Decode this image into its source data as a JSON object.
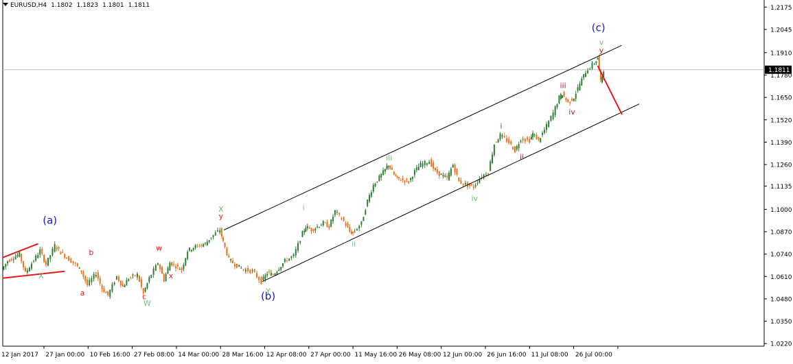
{
  "header": {
    "symbol": "EURUSD,H4",
    "open": "1.1802",
    "high": "1.1823",
    "low": "1.1801",
    "close": "1.1811"
  },
  "colors": {
    "bull_candle": "#2e7d32",
    "bear_candle": "#e8711a",
    "wave_red": "#e41b1b",
    "wave_green": "#6cc070",
    "wave_blue": "#1a1ad4",
    "minor_red": "#c2185b",
    "channel": "#000000",
    "axis": "#000000",
    "current_price_line": "#c0c0c0"
  },
  "chart_data": {
    "type": "candlestick",
    "title": "EURUSD,H4",
    "ylim": [
      1.0205,
      1.2208
    ],
    "y_ticks": [
      "1.2175",
      "1.2045",
      "1.1910",
      "1.1780",
      "1.1650",
      "1.1520",
      "1.1390",
      "1.1260",
      "1.1135",
      "1.1000",
      "1.0870",
      "1.0740",
      "1.0610",
      "1.0480",
      "1.0350",
      "1.0220"
    ],
    "x_ticks": [
      "12 Jan 2017",
      "27 Jan 00:00",
      "10 Feb 16:00",
      "27 Feb 08:00",
      "14 Mar 00:00",
      "28 Mar 16:00",
      "12 Apr 08:00",
      "27 Apr 00:00",
      "11 May 16:00",
      "26 May 08:00",
      "12 Jun 00:00",
      "26 Jun 16:00",
      "11 Jul 08:00",
      "26 Jul 00:00"
    ],
    "current_price": "1.1811",
    "grid": false,
    "price_path": [
      {
        "date": "12 Jan 2017",
        "price": 1.065
      },
      {
        "date": "14 Jan 2017",
        "price": 1.07
      },
      {
        "date": "18 Jan 2017",
        "price": 1.074
      },
      {
        "date": "20 Jan 2017",
        "price": 1.063
      },
      {
        "date": "25 Jan 2017",
        "price": 1.076
      },
      {
        "date": "27 Jan 2017",
        "price": 1.068
      },
      {
        "date": "30 Jan 2017",
        "price": 1.079
      },
      {
        "date": "01 Feb 2017",
        "price": 1.075
      },
      {
        "date": "03 Feb 2017",
        "price": 1.072
      },
      {
        "date": "06 Feb 2017",
        "price": 1.068
      },
      {
        "date": "08 Feb 2017",
        "price": 1.064
      },
      {
        "date": "10 Feb 2017",
        "price": 1.056
      },
      {
        "date": "13 Feb 2017",
        "price": 1.063
      },
      {
        "date": "15 Feb 2017",
        "price": 1.054
      },
      {
        "date": "17 Feb 2017",
        "price": 1.05
      },
      {
        "date": "20 Feb 2017",
        "price": 1.061
      },
      {
        "date": "22 Feb 2017",
        "price": 1.055
      },
      {
        "date": "24 Feb 2017",
        "price": 1.06
      },
      {
        "date": "27 Feb 2017",
        "price": 1.062
      },
      {
        "date": "01 Mar 2017",
        "price": 1.051
      },
      {
        "date": "03 Mar 2017",
        "price": 1.06
      },
      {
        "date": "06 Mar 2017",
        "price": 1.069
      },
      {
        "date": "08 Mar 2017",
        "price": 1.059
      },
      {
        "date": "10 Mar 2017",
        "price": 1.069
      },
      {
        "date": "14 Mar 2017",
        "price": 1.065
      },
      {
        "date": "16 Mar 2017",
        "price": 1.076
      },
      {
        "date": "18 Mar 2017",
        "price": 1.078
      },
      {
        "date": "22 Mar 2017",
        "price": 1.08
      },
      {
        "date": "24 Mar 2017",
        "price": 1.084
      },
      {
        "date": "27 Mar 2017",
        "price": 1.088
      },
      {
        "date": "28 Mar 2017",
        "price": 1.081
      },
      {
        "date": "30 Mar 2017",
        "price": 1.071
      },
      {
        "date": "01 Apr 2017",
        "price": 1.068
      },
      {
        "date": "04 Apr 2017",
        "price": 1.065
      },
      {
        "date": "07 Apr 2017",
        "price": 1.064
      },
      {
        "date": "10 Apr 2017",
        "price": 1.058
      },
      {
        "date": "12 Apr 2017",
        "price": 1.063
      },
      {
        "date": "14 Apr 2017",
        "price": 1.062
      },
      {
        "date": "18 Apr 2017",
        "price": 1.07
      },
      {
        "date": "21 Apr 2017",
        "price": 1.073
      },
      {
        "date": "24 Apr 2017",
        "price": 1.086
      },
      {
        "date": "25 Apr 2017",
        "price": 1.09
      },
      {
        "date": "27 Apr 2017",
        "price": 1.088
      },
      {
        "date": "01 May 2017",
        "price": 1.092
      },
      {
        "date": "03 May 2017",
        "price": 1.09
      },
      {
        "date": "05 May 2017",
        "price": 1.099
      },
      {
        "date": "08 May 2017",
        "price": 1.093
      },
      {
        "date": "10 May 2017",
        "price": 1.087
      },
      {
        "date": "11 May 2017",
        "price": 1.086
      },
      {
        "date": "14 May 2017",
        "price": 1.092
      },
      {
        "date": "16 May 2017",
        "price": 1.105
      },
      {
        "date": "18 May 2017",
        "price": 1.114
      },
      {
        "date": "22 May 2017",
        "price": 1.123
      },
      {
        "date": "23 May 2017",
        "price": 1.126
      },
      {
        "date": "25 May 2017",
        "price": 1.12
      },
      {
        "date": "26 May 2017",
        "price": 1.118
      },
      {
        "date": "30 May 2017",
        "price": 1.116
      },
      {
        "date": "01 Jun 2017",
        "price": 1.122
      },
      {
        "date": "03 Jun 2017",
        "price": 1.126
      },
      {
        "date": "06 Jun 2017",
        "price": 1.128
      },
      {
        "date": "08 Jun 2017",
        "price": 1.122
      },
      {
        "date": "10 Jun 2017",
        "price": 1.12
      },
      {
        "date": "12 Jun 2017",
        "price": 1.118
      },
      {
        "date": "14 Jun 2017",
        "price": 1.126
      },
      {
        "date": "16 Jun 2017",
        "price": 1.116
      },
      {
        "date": "19 Jun 2017",
        "price": 1.114
      },
      {
        "date": "21 Jun 2017",
        "price": 1.113
      },
      {
        "date": "23 Jun 2017",
        "price": 1.118
      },
      {
        "date": "26 Jun 2017",
        "price": 1.122
      },
      {
        "date": "28 Jun 2017",
        "price": 1.138
      },
      {
        "date": "30 Jun 2017",
        "price": 1.143
      },
      {
        "date": "03 Jul 2017",
        "price": 1.139
      },
      {
        "date": "05 Jul 2017",
        "price": 1.134
      },
      {
        "date": "07 Jul 2017",
        "price": 1.141
      },
      {
        "date": "10 Jul 2017",
        "price": 1.14
      },
      {
        "date": "11 Jul 2017",
        "price": 1.144
      },
      {
        "date": "13 Jul 2017",
        "price": 1.14
      },
      {
        "date": "15 Jul 2017",
        "price": 1.146
      },
      {
        "date": "18 Jul 2017",
        "price": 1.156
      },
      {
        "date": "20 Jul 2017",
        "price": 1.165
      },
      {
        "date": "21 Jul 2017",
        "price": 1.167
      },
      {
        "date": "23 Jul 2017",
        "price": 1.162
      },
      {
        "date": "25 Jul 2017",
        "price": 1.165
      },
      {
        "date": "27 Jul 2017",
        "price": 1.173
      },
      {
        "date": "29 Jul 2017",
        "price": 1.18
      },
      {
        "date": "01 Aug 2017",
        "price": 1.185
      },
      {
        "date": "02 Aug 2017",
        "price": 1.188
      },
      {
        "date": "03 Aug 2017",
        "price": 1.174
      },
      {
        "date": "04 Aug 2017",
        "price": 1.1811
      }
    ],
    "channel_lines": [
      {
        "name": "upper",
        "points": [
          {
            "date": "28 Mar 2017",
            "price": 1.088
          },
          {
            "date": "04 Aug 2017",
            "price": 1.192
          }
        ]
      },
      {
        "name": "lower",
        "points": [
          {
            "date": "10 Apr 2017",
            "price": 1.058
          },
          {
            "date": "10 Aug 2017",
            "price": 1.158
          }
        ]
      }
    ],
    "triangle_lines": [
      {
        "name": "top",
        "points": [
          {
            "date": "12 Jan 2017",
            "price": 1.072
          },
          {
            "date": "24 Jan 2017",
            "price": 1.08
          }
        ]
      },
      {
        "name": "bottom",
        "points": [
          {
            "date": "12 Jan 2017",
            "price": 1.06
          },
          {
            "date": "02 Feb 2017",
            "price": 1.064
          }
        ]
      }
    ],
    "projection_line": {
      "points": [
        {
          "date": "05 Aug 2017",
          "price": 1.181
        },
        {
          "date": "10 Aug 2017",
          "price": 1.155
        }
      ]
    },
    "wave_labels": [
      {
        "text": "(a)",
        "date": "28 Jan 2017",
        "price": 1.0915,
        "color": "blue"
      },
      {
        "text": "X",
        "date": "25 Jan 2017",
        "price": 1.06,
        "color": "green"
      },
      {
        "text": "a",
        "date": "08 Feb 2017",
        "price": 1.05,
        "color": "red"
      },
      {
        "text": "b",
        "date": "11 Feb 2017",
        "price": 1.0735,
        "color": "red"
      },
      {
        "text": "c",
        "date": "01 Mar 2017",
        "price": 1.0478,
        "color": "red"
      },
      {
        "text": "W",
        "date": "02 Mar 2017",
        "price": 1.044,
        "color": "green"
      },
      {
        "text": "w",
        "date": "06 Mar 2017",
        "price": 1.076,
        "color": "red"
      },
      {
        "text": "x",
        "date": "10 Mar 2017",
        "price": 1.06,
        "color": "red"
      },
      {
        "text": "X",
        "date": "27 Mar 2017",
        "price": 1.0985,
        "color": "green"
      },
      {
        "text": "y",
        "date": "27 Mar 2017",
        "price": 1.0945,
        "color": "red"
      },
      {
        "text": "Y",
        "date": "12 Apr 2017",
        "price": 1.051,
        "color": "green"
      },
      {
        "text": "(b)",
        "date": "12 Apr 2017",
        "price": 1.0475,
        "color": "blue"
      },
      {
        "text": "i",
        "date": "24 Apr 2017",
        "price": 1.0995,
        "color": "green"
      },
      {
        "text": "ii",
        "date": "11 May 2017",
        "price": 1.0785,
        "color": "green"
      },
      {
        "text": "iii",
        "date": "23 May 2017",
        "price": 1.1285,
        "color": "green"
      },
      {
        "text": "iv",
        "date": "21 Jun 2017",
        "price": 1.105,
        "color": "green"
      },
      {
        "text": "i",
        "date": "30 Jun 2017",
        "price": 1.147,
        "color": "minor"
      },
      {
        "text": "ii",
        "date": "07 Jul 2017",
        "price": 1.129,
        "color": "minor"
      },
      {
        "text": "iii",
        "date": "21 Jul 2017",
        "price": 1.1705,
        "color": "minor"
      },
      {
        "text": "iv",
        "date": "24 Jul 2017",
        "price": 1.155,
        "color": "minor"
      },
      {
        "text": "v",
        "date": "03 Aug 2017",
        "price": 1.1955,
        "color": "green"
      },
      {
        "text": "y",
        "date": "03 Aug 2017",
        "price": 1.191,
        "color": "red"
      },
      {
        "text": "(c)",
        "date": "02 Aug 2017",
        "price": 1.2035,
        "color": "blue"
      }
    ]
  }
}
